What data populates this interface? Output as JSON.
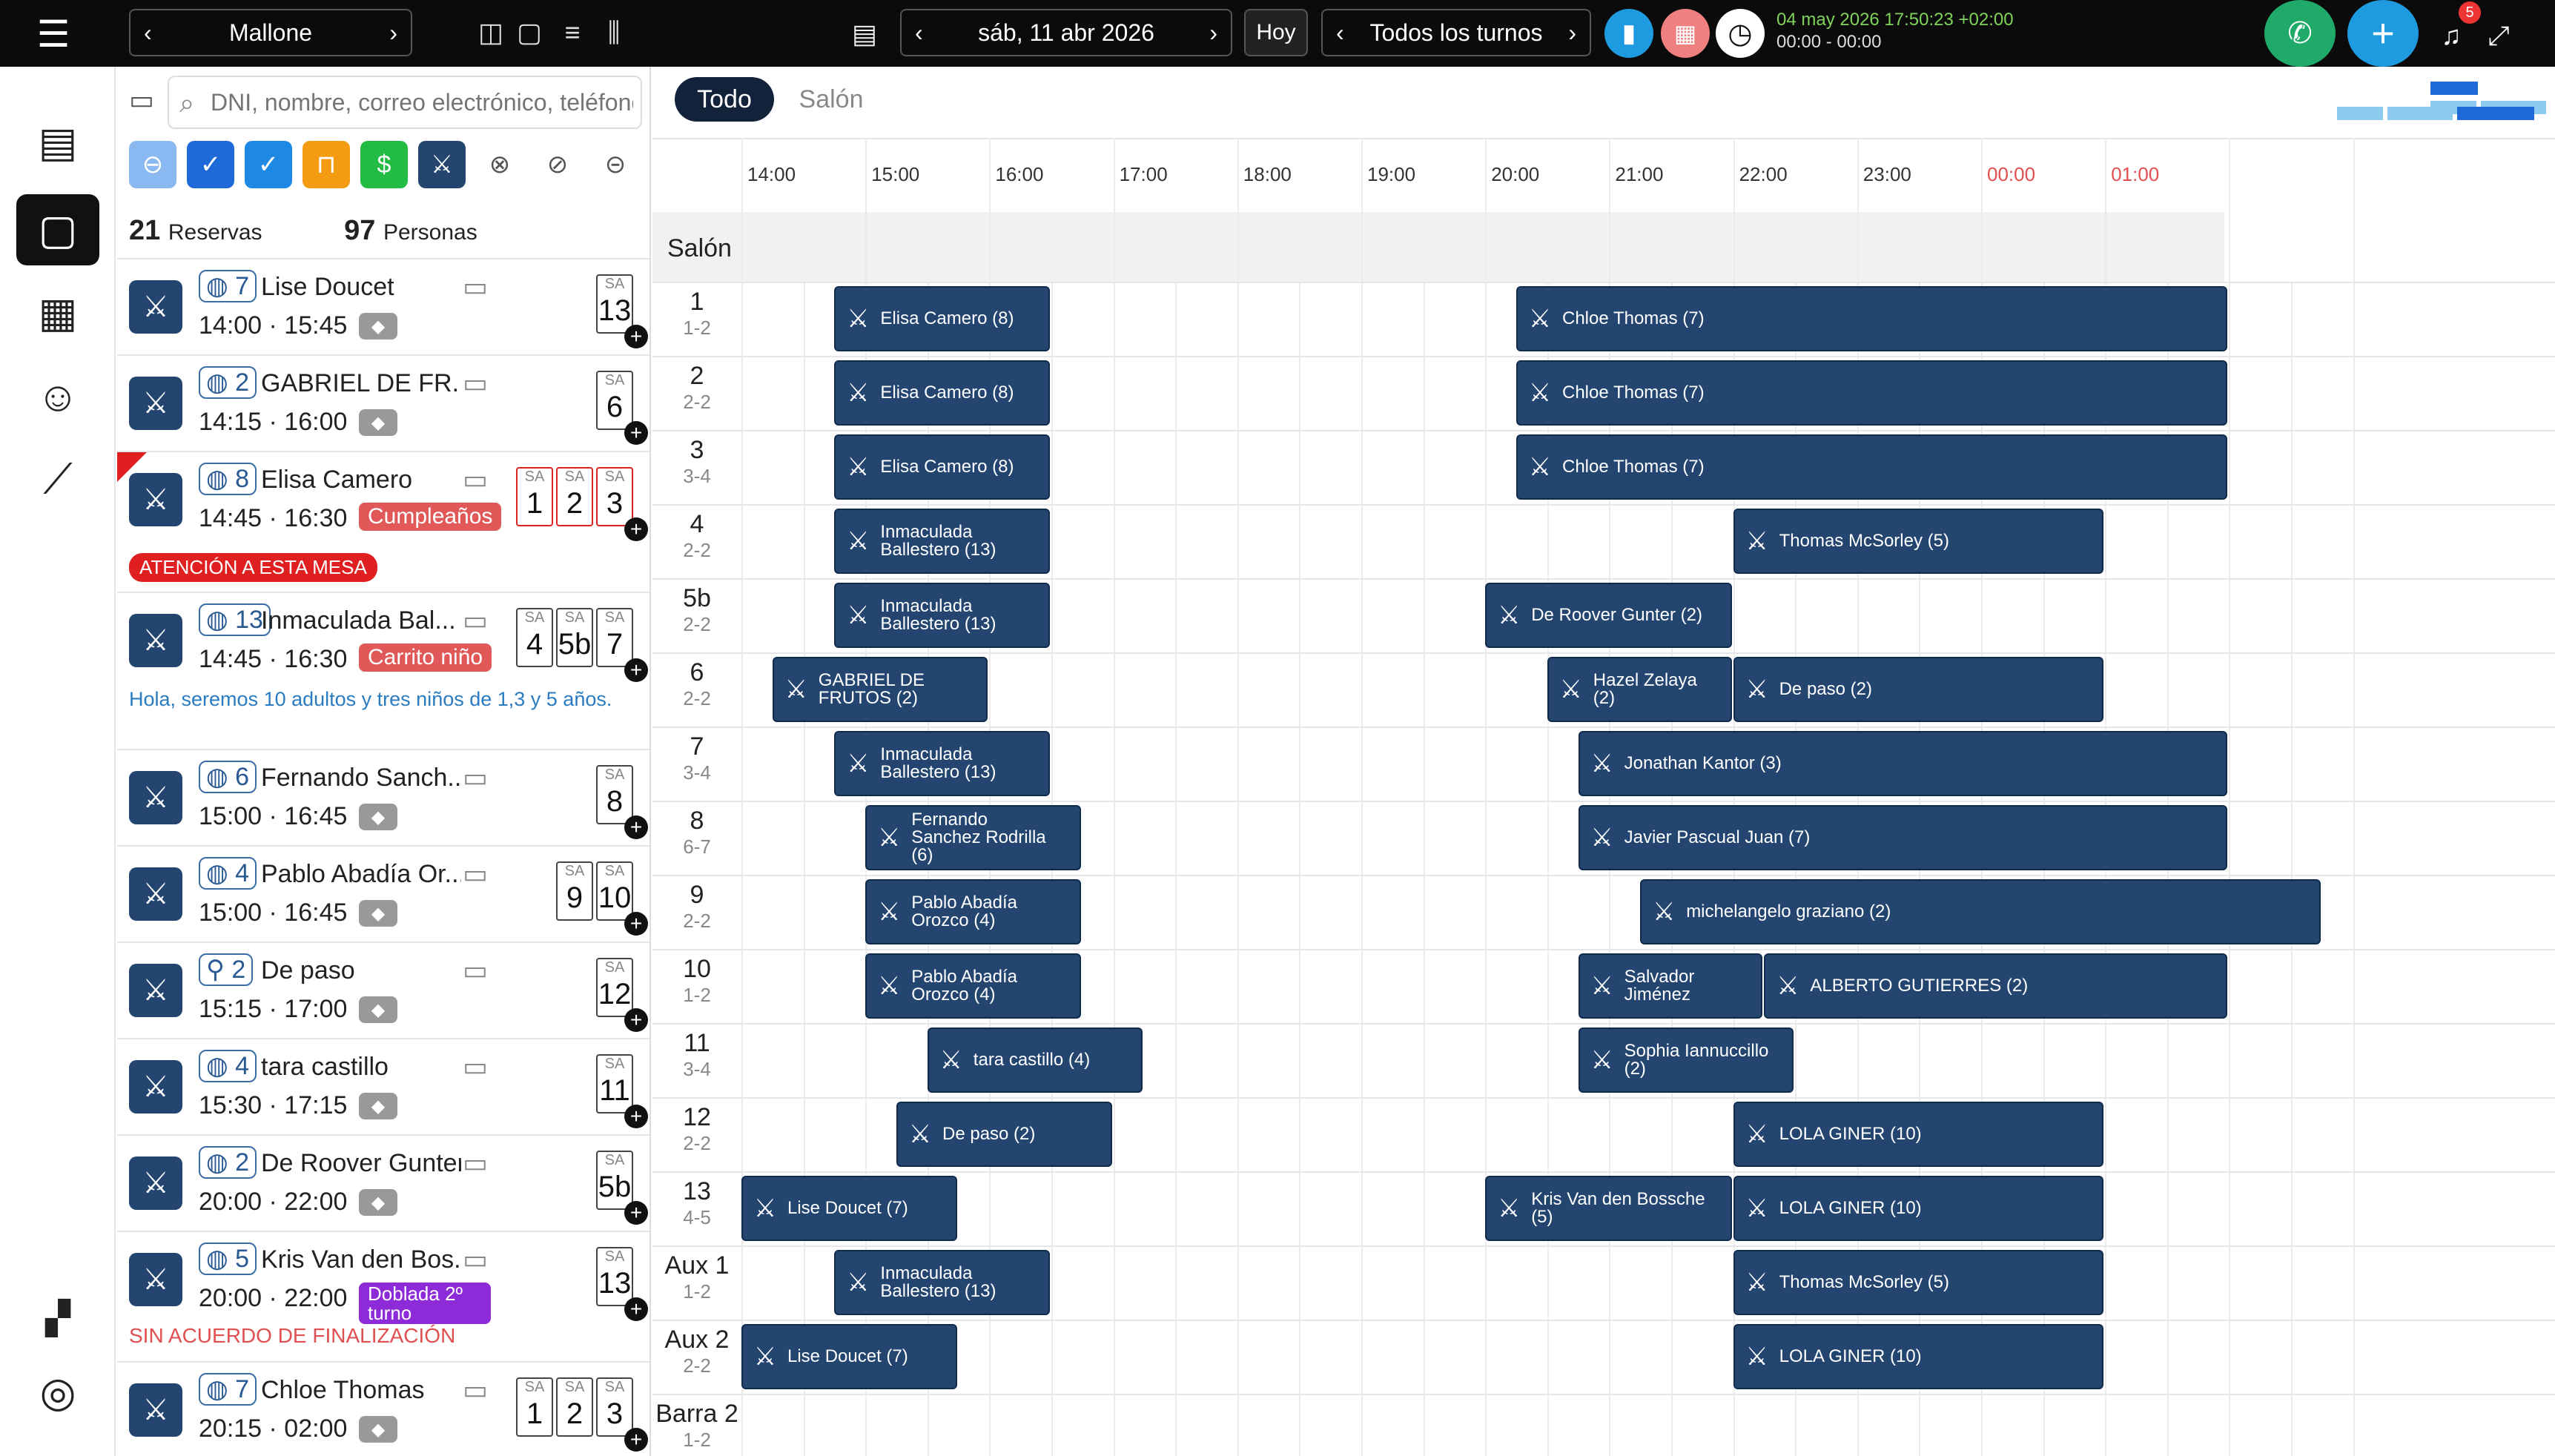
{
  "topbar": {
    "restaurant": "Mallone",
    "date": "sáb, 11 abr 2026",
    "today": "Hoy",
    "shift": "Todos los turnos",
    "clock_line1": "04 may 2026 17:50:23 +02:00",
    "clock_line2": "00:00 - 00:00",
    "notifications": "5"
  },
  "search": {
    "placeholder": "DNI, nombre, correo electrónico, teléfono"
  },
  "counts": {
    "reservations": "21",
    "reservations_label": "Reservas",
    "people": "97",
    "people_label": "Personas"
  },
  "reservations": [
    {
      "pax": "7",
      "name": "Lise Doucet",
      "start": "14:00",
      "end": "15:45",
      "tables": [
        "13"
      ]
    },
    {
      "pax": "2",
      "name": "GABRIEL DE FR...",
      "start": "14:15",
      "end": "16:00",
      "tables": [
        "6"
      ]
    },
    {
      "pax": "8",
      "name": "Elisa Camero",
      "start": "14:45",
      "end": "16:30",
      "tag": "Cumpleaños",
      "tables": [
        "1",
        "2",
        "3"
      ],
      "alert": "ATENCIÓN A ESTA MESA"
    },
    {
      "pax": "13",
      "name": "Inmaculada Bal...",
      "start": "14:45",
      "end": "16:30",
      "tag": "Carrito niño",
      "tables": [
        "4",
        "5b",
        "7"
      ],
      "note": "Hola, seremos 10 adultos y tres niños de 1,3 y 5 años."
    },
    {
      "pax": "6",
      "name": "Fernando Sanch...",
      "start": "15:00",
      "end": "16:45",
      "tables": [
        "8"
      ]
    },
    {
      "pax": "4",
      "name": "Pablo Abadía Or...",
      "start": "15:00",
      "end": "16:45",
      "tables": [
        "9",
        "10"
      ]
    },
    {
      "pax": "2",
      "name": "De paso",
      "start": "15:15",
      "end": "17:00",
      "tables": [
        "12"
      ]
    },
    {
      "pax": "4",
      "name": "tara castillo",
      "start": "15:30",
      "end": "17:15",
      "tables": [
        "11"
      ]
    },
    {
      "pax": "2",
      "name": "De Roover Gunter",
      "start": "20:00",
      "end": "22:00",
      "tables": [
        "5b"
      ]
    },
    {
      "pax": "5",
      "name": "Kris Van den Bos...",
      "start": "20:00",
      "end": "22:00",
      "tag": "Doblada 2º turno",
      "tables": [
        "13"
      ],
      "warn": "SIN ACUERDO DE FINALIZACIÓN"
    },
    {
      "pax": "7",
      "name": "Chloe Thomas",
      "start": "20:15",
      "end": "02:00",
      "tables": [
        "1",
        "2",
        "3"
      ]
    }
  ],
  "table_prefix": "SA",
  "timeline": {
    "tabs": [
      "Todo",
      "Salón"
    ],
    "hours": [
      "14:00",
      "15:00",
      "16:00",
      "17:00",
      "18:00",
      "19:00",
      "20:00",
      "21:00",
      "22:00",
      "23:00",
      "00:00",
      "01:00"
    ],
    "section": "Salón",
    "rows": [
      {
        "t": "1",
        "c": "1-2"
      },
      {
        "t": "2",
        "c": "2-2"
      },
      {
        "t": "3",
        "c": "3-4"
      },
      {
        "t": "4",
        "c": "2-2"
      },
      {
        "t": "5b",
        "c": "2-2"
      },
      {
        "t": "6",
        "c": "2-2"
      },
      {
        "t": "7",
        "c": "3-4"
      },
      {
        "t": "8",
        "c": "6-7"
      },
      {
        "t": "9",
        "c": "2-2"
      },
      {
        "t": "10",
        "c": "1-2"
      },
      {
        "t": "11",
        "c": "3-4"
      },
      {
        "t": "12",
        "c": "2-2"
      },
      {
        "t": "13",
        "c": "4-5"
      },
      {
        "t": "Aux 1",
        "c": "1-2"
      },
      {
        "t": "Aux 2",
        "c": "2-2"
      },
      {
        "t": "Barra 2",
        "c": "1-2"
      }
    ],
    "bookings": [
      {
        "row": 0,
        "start": 14.75,
        "end": 16.5,
        "label": "Elisa Camero (8)"
      },
      {
        "row": 0,
        "start": 20.25,
        "end": 26.0,
        "label": "Chloe Thomas (7)"
      },
      {
        "row": 1,
        "start": 14.75,
        "end": 16.5,
        "label": "Elisa Camero (8)"
      },
      {
        "row": 1,
        "start": 20.25,
        "end": 26.0,
        "label": "Chloe Thomas (7)"
      },
      {
        "row": 2,
        "start": 14.75,
        "end": 16.5,
        "label": "Elisa Camero (8)"
      },
      {
        "row": 2,
        "start": 20.25,
        "end": 26.0,
        "label": "Chloe Thomas (7)"
      },
      {
        "row": 3,
        "start": 14.75,
        "end": 16.5,
        "label": "Inmaculada Ballestero (13)"
      },
      {
        "row": 3,
        "start": 22.0,
        "end": 25.0,
        "label": "Thomas McSorley (5)"
      },
      {
        "row": 4,
        "start": 14.75,
        "end": 16.5,
        "label": "Inmaculada Ballestero (13)"
      },
      {
        "row": 4,
        "start": 20.0,
        "end": 22.0,
        "label": "De Roover Gunter (2)"
      },
      {
        "row": 5,
        "start": 14.25,
        "end": 16.0,
        "label": "GABRIEL DE FRUTOS (2)"
      },
      {
        "row": 5,
        "start": 20.5,
        "end": 22.0,
        "label": "Hazel Zelaya (2)"
      },
      {
        "row": 5,
        "start": 22.0,
        "end": 25.0,
        "label": "De paso (2)"
      },
      {
        "row": 6,
        "start": 14.75,
        "end": 16.5,
        "label": "Inmaculada Ballestero (13)"
      },
      {
        "row": 6,
        "start": 20.75,
        "end": 26.0,
        "label": "Jonathan Kantor (3)"
      },
      {
        "row": 7,
        "start": 15.0,
        "end": 16.75,
        "label": "Fernando Sanchez Rodrilla (6)"
      },
      {
        "row": 7,
        "start": 20.75,
        "end": 26.0,
        "label": "Javier Pascual Juan (7)"
      },
      {
        "row": 8,
        "start": 15.0,
        "end": 16.75,
        "label": "Pablo Abadía Orozco (4)"
      },
      {
        "row": 8,
        "start": 21.25,
        "end": 26.75,
        "label": "michelangelo graziano (2)"
      },
      {
        "row": 9,
        "start": 15.0,
        "end": 16.75,
        "label": "Pablo Abadía Orozco (4)"
      },
      {
        "row": 9,
        "start": 20.75,
        "end": 22.25,
        "label": "Salvador Jiménez"
      },
      {
        "row": 9,
        "start": 22.25,
        "end": 26.0,
        "label": "ALBERTO GUTIERRES (2)"
      },
      {
        "row": 10,
        "start": 15.5,
        "end": 17.25,
        "label": "tara castillo (4)"
      },
      {
        "row": 10,
        "start": 20.75,
        "end": 22.5,
        "label": "Sophia Iannuccillo (2)"
      },
      {
        "row": 11,
        "start": 15.25,
        "end": 17.0,
        "label": "De paso (2)"
      },
      {
        "row": 11,
        "start": 22.0,
        "end": 25.0,
        "label": "LOLA GINER (10)"
      },
      {
        "row": 12,
        "start": 14.0,
        "end": 15.75,
        "label": "Lise Doucet (7)"
      },
      {
        "row": 12,
        "start": 20.0,
        "end": 22.0,
        "label": "Kris Van den Bossche (5)"
      },
      {
        "row": 12,
        "start": 22.0,
        "end": 25.0,
        "label": "LOLA GINER (10)"
      },
      {
        "row": 13,
        "start": 14.75,
        "end": 16.5,
        "label": "Inmaculada Ballestero (13)"
      },
      {
        "row": 13,
        "start": 22.0,
        "end": 25.0,
        "label": "Thomas McSorley (5)"
      },
      {
        "row": 14,
        "start": 14.0,
        "end": 15.75,
        "label": "Lise Doucet (7)"
      },
      {
        "row": 14,
        "start": 22.0,
        "end": 25.0,
        "label": "LOLA GINER (10)"
      }
    ]
  },
  "colors": {
    "booking": "#23456f",
    "accent_red": "#e02020",
    "midnight": "#e05050"
  }
}
